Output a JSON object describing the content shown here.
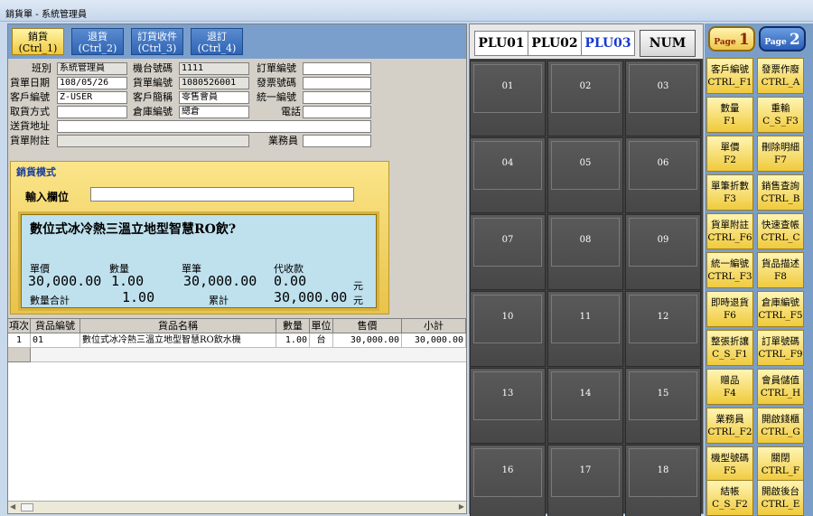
{
  "window": {
    "title": "銷貨單 - 系統管理員"
  },
  "tabs": [
    {
      "label": "銷貨",
      "key": "(Ctrl_1)"
    },
    {
      "label": "退貨",
      "key": "(Ctrl_2)"
    },
    {
      "label": "訂貨收件",
      "key": "(Ctrl_3)"
    },
    {
      "label": "退訂",
      "key": "(Ctrl_4)"
    }
  ],
  "form": {
    "shift_label": "班別",
    "shift_value": "系統管理員",
    "machine_label": "機台號碼",
    "machine_value": "1111",
    "order_no_label": "訂單編號",
    "order_no_value": "",
    "date_label": "貨單日期",
    "date_value": "108/05/26",
    "slip_no_label": "貨單編號",
    "slip_no_value": "1080526001",
    "invoice_label": "發票號碼",
    "invoice_value": "",
    "customer_no_label": "客戶編號",
    "customer_no_value": "Z-USER",
    "customer_name_label": "客戶簡稱",
    "customer_name_value": "零售會員",
    "tax_id_label": "統一編號",
    "tax_id_value": "",
    "pickup_label": "取貨方式",
    "pickup_value": "",
    "warehouse_label": "倉庫編號",
    "warehouse_value": "總倉",
    "phone_label": "電話",
    "phone_value": "",
    "address_label": "送貨地址",
    "address_value": "",
    "note_label": "貨單附註",
    "note_value": "",
    "sales_label": "業務員",
    "sales_value": ""
  },
  "mode": {
    "title": "銷貨模式",
    "input_label": "輸入欄位",
    "input_value": "",
    "product_name": "數位式冰冷熱三溫立地型智慧RO飲?",
    "price_label": "單價",
    "price_value": "30,000.00",
    "qty_label": "數量",
    "qty_value": "1.00",
    "amount_label": "單筆",
    "amount_value": "30,000.00",
    "collect_label": "代收款",
    "collect_value": "0.00",
    "yuan": "元",
    "qty_total_label": "數量合計",
    "qty_total_value": "1.00",
    "cumulative_label": "累計",
    "cumulative_value": "30,000.00",
    "yuan2": "元"
  },
  "grid": {
    "headers": [
      "項次",
      "貨品編號",
      "貨品名稱",
      "數量",
      "單位",
      "售價",
      "小計"
    ],
    "rows": [
      [
        "1",
        "01",
        "數位式冰冷熱三溫立地型智慧RO飲水機",
        "1.00",
        "台",
        "30,000.00",
        "30,000.00"
      ]
    ]
  },
  "plu": {
    "tabs": [
      "PLU01",
      "PLU02",
      "PLU03"
    ],
    "active_tab": "PLU03",
    "num_label": "NUM",
    "buttons": [
      "01",
      "02",
      "03",
      "04",
      "05",
      "06",
      "07",
      "08",
      "09",
      "10",
      "11",
      "12",
      "13",
      "14",
      "15",
      "16",
      "17",
      "18"
    ]
  },
  "pages": [
    {
      "prefix": "Page",
      "num": "1"
    },
    {
      "prefix": "Page",
      "num": "2"
    }
  ],
  "function_keys": [
    {
      "label": "客戶編號",
      "key": "CTRL_F1"
    },
    {
      "label": "發票作廢",
      "key": "CTRL_A"
    },
    {
      "label": "數量",
      "key": "F1"
    },
    {
      "label": "重輸",
      "key": "C_S_F3"
    },
    {
      "label": "單價",
      "key": "F2"
    },
    {
      "label": "刪除明細",
      "key": "F7"
    },
    {
      "label": "單筆折數",
      "key": "F3"
    },
    {
      "label": "銷售查詢",
      "key": "CTRL_B"
    },
    {
      "label": "貨單附註",
      "key": "CTRL_F6"
    },
    {
      "label": "快速查帳",
      "key": "CTRL_C"
    },
    {
      "label": "統一編號",
      "key": "CTRL_F3"
    },
    {
      "label": "貨品描述",
      "key": "F8"
    },
    {
      "label": "即時退貨",
      "key": "F6"
    },
    {
      "label": "倉庫編號",
      "key": "CTRL_F5"
    },
    {
      "label": "整張折讓",
      "key": "C_S_F1"
    },
    {
      "label": "訂單號碼",
      "key": "CTRL_F9"
    },
    {
      "label": "贈品",
      "key": "F4"
    },
    {
      "label": "會員儲值",
      "key": "CTRL_H"
    },
    {
      "label": "業務員",
      "key": "CTRL_F2"
    },
    {
      "label": "開啟錢櫃",
      "key": "CTRL_G"
    },
    {
      "label": "機型號碼",
      "key": "F5"
    },
    {
      "label": "關閉",
      "key": "CTRL_F"
    },
    {
      "label": "結帳",
      "key": "C_S_F2"
    },
    {
      "label": "開啟後台",
      "key": "CTRL_E"
    }
  ]
}
